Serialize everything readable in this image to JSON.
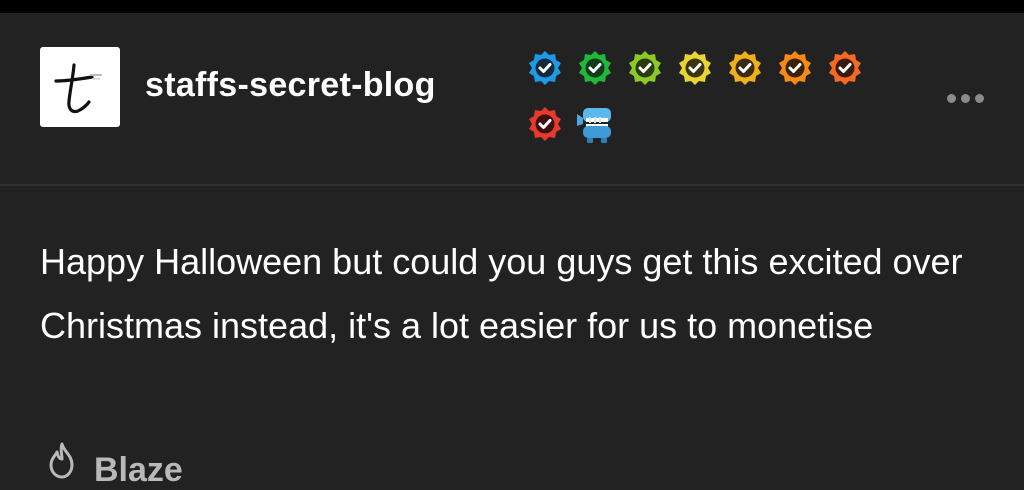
{
  "post": {
    "blog_name": "staffs-secret-blog",
    "body_text": "Happy Halloween but could you guys get this excited over Christmas instead, it's a lot easier for us to monetise"
  },
  "avatar": {
    "icon": "tumblr-t-logo",
    "glyph": "t"
  },
  "badges": [
    {
      "icon": "verified-checkmark-icon",
      "color": "#1e9be8"
    },
    {
      "icon": "verified-checkmark-icon",
      "color": "#1fb83a"
    },
    {
      "icon": "verified-checkmark-icon",
      "color": "#8ac926"
    },
    {
      "icon": "verified-checkmark-icon",
      "color": "#e8d534"
    },
    {
      "icon": "verified-checkmark-icon",
      "color": "#f0b01a"
    },
    {
      "icon": "verified-checkmark-icon",
      "color": "#f58a14"
    },
    {
      "icon": "verified-checkmark-icon",
      "color": "#f46a24"
    },
    {
      "icon": "verified-checkmark-icon",
      "color": "#e8392c"
    },
    {
      "icon": "chattering-teeth-icon",
      "color": "#4aa8e0"
    }
  ],
  "actions": {
    "more_icon": "more-options-icon",
    "blaze_label": "Blaze",
    "blaze_icon": "flame-icon"
  },
  "colors": {
    "background": "#222222",
    "text": "#ffffff",
    "muted": "#8b8b8b"
  }
}
